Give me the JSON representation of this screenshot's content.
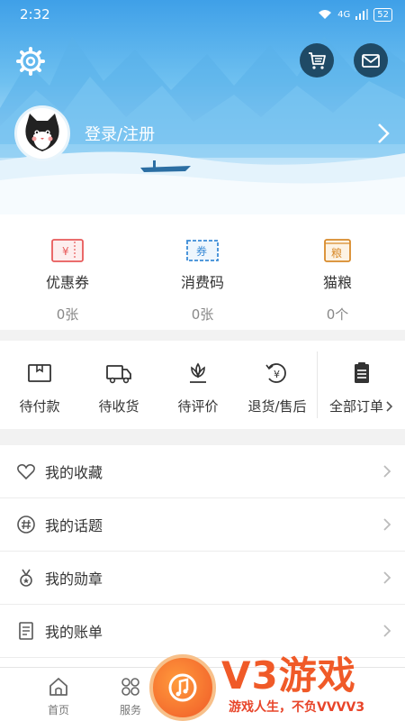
{
  "status_bar": {
    "time": "2:32",
    "signal_text": "4G",
    "battery": "52"
  },
  "header": {
    "login_text": "登录/注册"
  },
  "assets": [
    {
      "label": "优惠券",
      "value": "0张",
      "icon": "coupon-icon",
      "icon_char": "¥"
    },
    {
      "label": "消费码",
      "value": "0张",
      "icon": "voucher-code-icon",
      "icon_char": "券"
    },
    {
      "label": "猫粮",
      "value": "0个",
      "icon": "cat-food-icon",
      "icon_char": "粮"
    }
  ],
  "orders": [
    {
      "label": "待付款",
      "icon": "wallet-icon"
    },
    {
      "label": "待收货",
      "icon": "truck-icon"
    },
    {
      "label": "待评价",
      "icon": "flower-review-icon"
    },
    {
      "label": "退货/售后",
      "icon": "refund-icon"
    }
  ],
  "orders_all": {
    "label": "全部订单"
  },
  "menu": [
    {
      "label": "我的收藏",
      "icon": "heart-icon"
    },
    {
      "label": "我的话题",
      "icon": "hashtag-icon"
    },
    {
      "label": "我的勋章",
      "icon": "medal-icon"
    },
    {
      "label": "我的账单",
      "icon": "bill-icon"
    }
  ],
  "bottom_nav": [
    {
      "label": "首页",
      "icon": "home-icon"
    },
    {
      "label": "服务",
      "icon": "grid-icon"
    }
  ],
  "watermark": {
    "big": "V3游戏",
    "small": "游戏人生，不负VVVV3"
  },
  "colors": {
    "accent": "#f05a28",
    "coupon_red": "#e85a5a",
    "code_blue": "#3a8bd6",
    "food_orange": "#d88a2a",
    "header_blue": "#3fa0e8"
  }
}
